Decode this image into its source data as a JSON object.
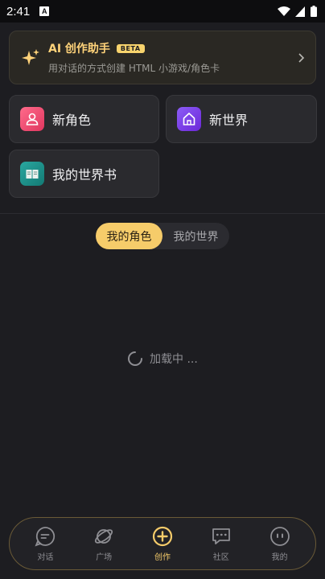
{
  "status_bar": {
    "time": "2:41",
    "app_badge": "A"
  },
  "ai_banner": {
    "title": "AI 创作助手",
    "badge": "BETA",
    "subtitle": "用对话的方式创建 HTML 小游戏/角色卡"
  },
  "actions": [
    {
      "label": "新角色",
      "icon": "user-icon"
    },
    {
      "label": "新世界",
      "icon": "home-icon"
    },
    {
      "label": "我的世界书",
      "icon": "book-icon"
    }
  ],
  "segmented": {
    "options": [
      "我的角色",
      "我的世界"
    ],
    "selected": "我的角色"
  },
  "loading_text": "加载中 ...",
  "bottom_nav": [
    {
      "label": "对话",
      "icon": "chat-icon"
    },
    {
      "label": "广场",
      "icon": "planet-icon"
    },
    {
      "label": "创作",
      "icon": "plus-circle-icon",
      "active": true
    },
    {
      "label": "社区",
      "icon": "message-icon"
    },
    {
      "label": "我的",
      "icon": "profile-face-icon"
    }
  ],
  "colors": {
    "accent": "#f6cc6a",
    "background": "#1d1d21",
    "card": "#2a2a2e"
  }
}
